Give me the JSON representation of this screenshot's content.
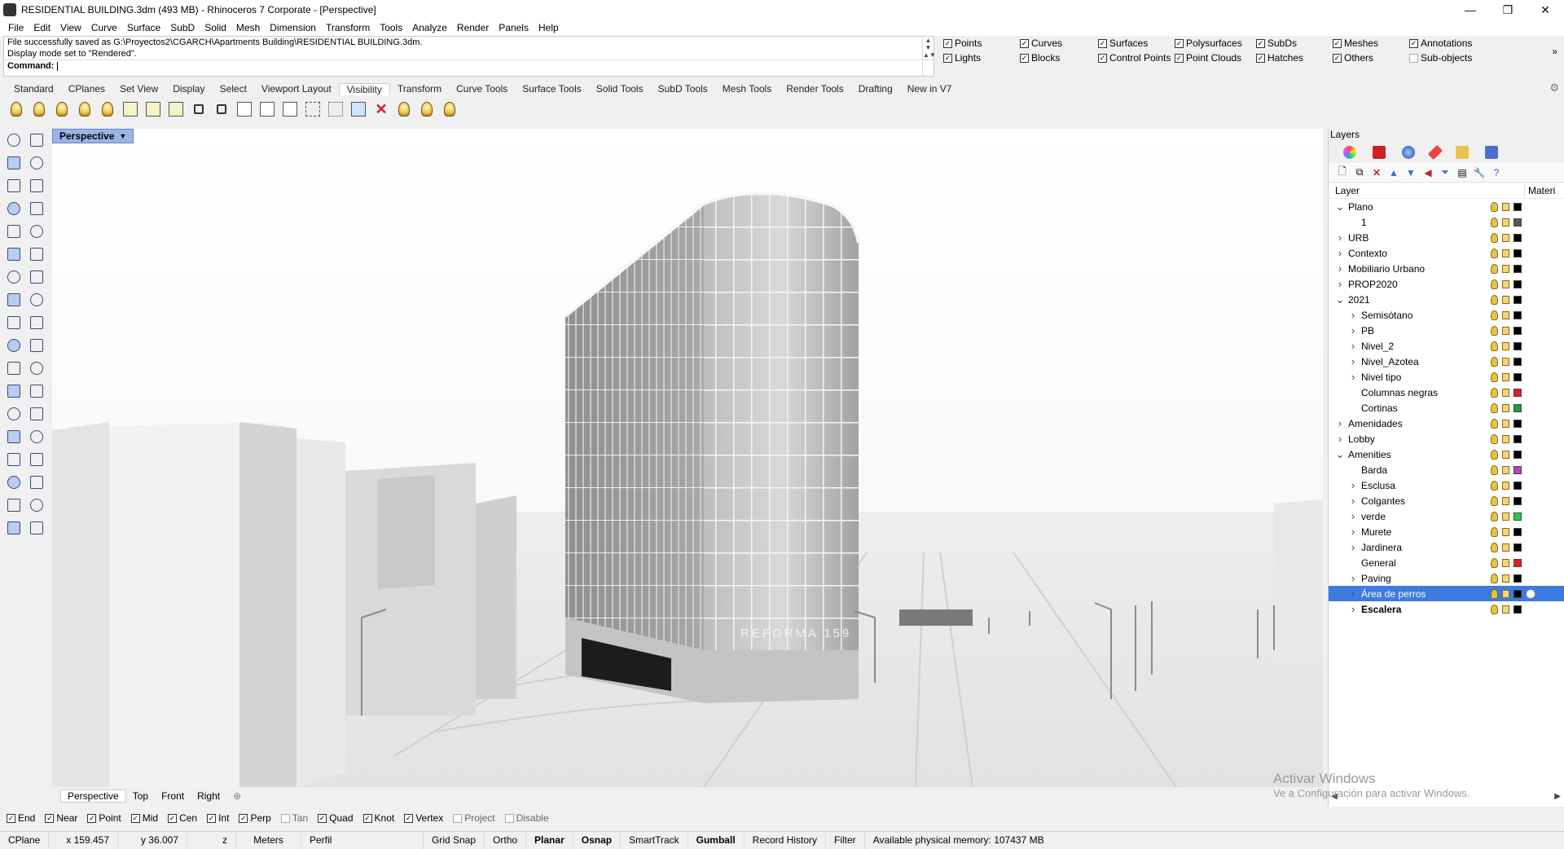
{
  "window": {
    "title": "RESIDENTIAL BUILDING.3dm (493 MB) - Rhinoceros 7 Corporate - [Perspective]"
  },
  "menu": [
    "File",
    "Edit",
    "View",
    "Curve",
    "Surface",
    "SubD",
    "Solid",
    "Mesh",
    "Dimension",
    "Transform",
    "Tools",
    "Analyze",
    "Render",
    "Panels",
    "Help"
  ],
  "command_history": [
    "File successfully saved as G:\\Proyectos2\\CGARCH\\Apartments Building\\RESIDENTIAL BUILDING.3dm.",
    "Display mode set to \"Rendered\"."
  ],
  "command_prompt": "Command:",
  "filters": {
    "row1": [
      {
        "label": "Points",
        "checked": true
      },
      {
        "label": "Curves",
        "checked": true
      },
      {
        "label": "Surfaces",
        "checked": true
      },
      {
        "label": "Polysurfaces",
        "checked": true
      },
      {
        "label": "SubDs",
        "checked": true
      },
      {
        "label": "Meshes",
        "checked": true
      },
      {
        "label": "Annotations",
        "checked": true
      }
    ],
    "row2": [
      {
        "label": "Lights",
        "checked": true
      },
      {
        "label": "Blocks",
        "checked": true
      },
      {
        "label": "Control Points",
        "checked": true
      },
      {
        "label": "Point Clouds",
        "checked": true
      },
      {
        "label": "Hatches",
        "checked": true
      },
      {
        "label": "Others",
        "checked": true
      },
      {
        "label": "Sub-objects",
        "checked": false
      }
    ]
  },
  "toolbar_tabs": [
    "Standard",
    "CPlanes",
    "Set View",
    "Display",
    "Select",
    "Viewport Layout",
    "Visibility",
    "Transform",
    "Curve Tools",
    "Surface Tools",
    "Solid Tools",
    "SubD Tools",
    "Mesh Tools",
    "Render Tools",
    "Drafting",
    "New in V7"
  ],
  "active_toolbar_tab": "Visibility",
  "viewport": {
    "title": "Perspective",
    "building_sign": "REFORMA 159",
    "tabs": [
      "Perspective",
      "Top",
      "Front",
      "Right"
    ]
  },
  "osnaps": [
    {
      "label": "End",
      "checked": true
    },
    {
      "label": "Near",
      "checked": true
    },
    {
      "label": "Point",
      "checked": true
    },
    {
      "label": "Mid",
      "checked": true
    },
    {
      "label": "Cen",
      "checked": true
    },
    {
      "label": "Int",
      "checked": true
    },
    {
      "label": "Perp",
      "checked": true
    },
    {
      "label": "Tan",
      "checked": false
    },
    {
      "label": "Quad",
      "checked": true
    },
    {
      "label": "Knot",
      "checked": true
    },
    {
      "label": "Vertex",
      "checked": true
    },
    {
      "label": "Project",
      "checked": false
    },
    {
      "label": "Disable",
      "checked": false
    }
  ],
  "status": {
    "cplane": "CPlane",
    "x": "x 159.457",
    "y": "y 36.007",
    "z": "z",
    "units": "Meters",
    "layer": "Perfil",
    "grid_snap": "Grid Snap",
    "ortho": "Ortho",
    "planar": "Planar",
    "osnap": "Osnap",
    "smarttrack": "SmartTrack",
    "gumball": "Gumball",
    "record_history": "Record History",
    "filter": "Filter",
    "memory": "Available physical memory: 107437 MB"
  },
  "layers_panel": {
    "title": "Layers",
    "col_layer": "Layer",
    "col_material": "Materi",
    "rows": [
      {
        "name": "Plano",
        "indent": 0,
        "expand": "down",
        "color": "#000000"
      },
      {
        "name": "1",
        "indent": 1,
        "expand": "",
        "color": "#555555"
      },
      {
        "name": "URB",
        "indent": 0,
        "expand": "right",
        "color": "#000000"
      },
      {
        "name": "Contexto",
        "indent": 0,
        "expand": "right",
        "color": "#000000"
      },
      {
        "name": "Mobiliario Urbano",
        "indent": 0,
        "expand": "right",
        "color": "#000000"
      },
      {
        "name": "PROP2020",
        "indent": 0,
        "expand": "right",
        "color": "#000000"
      },
      {
        "name": "2021",
        "indent": 0,
        "expand": "down",
        "color": "#000000"
      },
      {
        "name": "Semisótano",
        "indent": 1,
        "expand": "right",
        "color": "#000000"
      },
      {
        "name": "PB",
        "indent": 1,
        "expand": "right",
        "color": "#000000"
      },
      {
        "name": "Nivel_2",
        "indent": 1,
        "expand": "right",
        "color": "#000000"
      },
      {
        "name": "Nivel_Azotea",
        "indent": 1,
        "expand": "right",
        "color": "#000000"
      },
      {
        "name": "Nivel tipo",
        "indent": 1,
        "expand": "right",
        "color": "#000000"
      },
      {
        "name": "Columnas negras",
        "indent": 1,
        "expand": "",
        "color": "#e02020"
      },
      {
        "name": "Cortinas",
        "indent": 1,
        "expand": "",
        "color": "#18a030"
      },
      {
        "name": "Amenidades",
        "indent": 0,
        "expand": "right",
        "color": "#000000"
      },
      {
        "name": "Lobby",
        "indent": 0,
        "expand": "right",
        "color": "#000000"
      },
      {
        "name": "Amenities",
        "indent": 0,
        "expand": "down",
        "color": "#000000"
      },
      {
        "name": "Barda",
        "indent": 1,
        "expand": "",
        "color": "#c040c0"
      },
      {
        "name": "Esclusa",
        "indent": 1,
        "expand": "right",
        "color": "#000000"
      },
      {
        "name": "Colgantes",
        "indent": 1,
        "expand": "right",
        "color": "#000000"
      },
      {
        "name": "verde",
        "indent": 1,
        "expand": "right",
        "color": "#20d040"
      },
      {
        "name": "Murete",
        "indent": 1,
        "expand": "right",
        "color": "#000000"
      },
      {
        "name": "Jardinera",
        "indent": 1,
        "expand": "right",
        "color": "#000000"
      },
      {
        "name": "General",
        "indent": 1,
        "expand": "",
        "color": "#e02020"
      },
      {
        "name": "Paving",
        "indent": 1,
        "expand": "right",
        "color": "#000000"
      },
      {
        "name": "Área de perros",
        "indent": 1,
        "expand": "right",
        "color": "#000000",
        "selected": true
      },
      {
        "name": "Escalera",
        "indent": 1,
        "expand": "right",
        "color": "#000000",
        "bold": true
      }
    ]
  },
  "watermark": {
    "line1": "Activar Windows",
    "line2": "Ve a Configuración para activar Windows."
  }
}
